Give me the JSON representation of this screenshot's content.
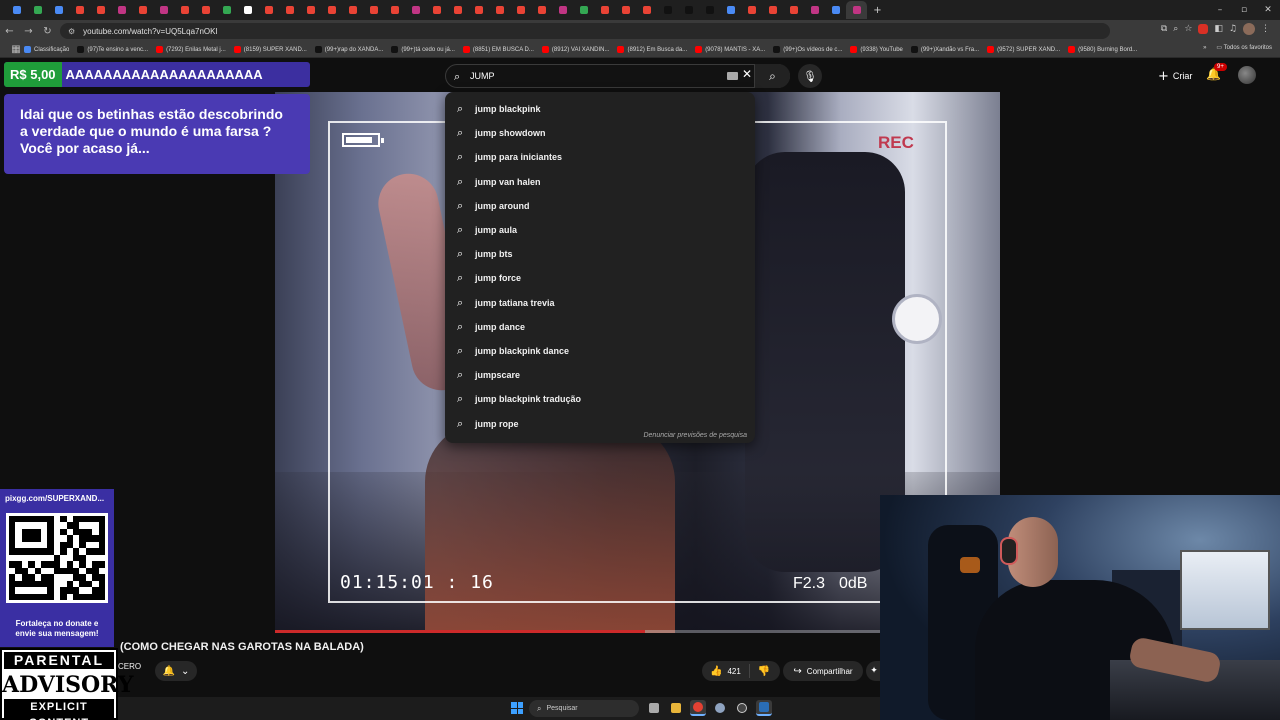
{
  "browser": {
    "url": "youtube.com/watch?v=UQ5Lqa7nOKI",
    "bookmarks": [
      {
        "label": "Classificação",
        "color": "#4a8af4"
      },
      {
        "label": "(97)Te ensino a venc...",
        "color": "#111111"
      },
      {
        "label": "(7292) Enilas Metal j...",
        "color": "#ff0000"
      },
      {
        "label": "(8159) SUPER XAND...",
        "color": "#ff0000"
      },
      {
        "label": "(99+)rap do XANDÃ...",
        "color": "#111111"
      },
      {
        "label": "(99+)tá cedo ou já...",
        "color": "#111111"
      },
      {
        "label": "(8851) EM BUSCA D...",
        "color": "#ff0000"
      },
      {
        "label": "(8912) VAI XANDIN...",
        "color": "#ff0000"
      },
      {
        "label": "(8912) Em Busca da...",
        "color": "#ff0000"
      },
      {
        "label": "(9078) MANTIS - XA...",
        "color": "#ff0000"
      },
      {
        "label": "(99+)Os vídeos de c...",
        "color": "#111111"
      },
      {
        "label": "(9338) YouTube",
        "color": "#ff0000"
      },
      {
        "label": "(99+)Xandão vs Fra...",
        "color": "#111111"
      },
      {
        "label": "(9572) SUPER XAND...",
        "color": "#ff0000"
      },
      {
        "label": "(9580) Burning Bord...",
        "color": "#ff0000"
      }
    ],
    "all_bookmarks": "Todos os favoritos"
  },
  "youtube": {
    "search_value": "JUMP",
    "create_label": "Criar",
    "notifications_badge": "9+",
    "suggestions": [
      "jump blackpink",
      "jump showdown",
      "jump para iniciantes",
      "jump van halen",
      "jump around",
      "jump aula",
      "jump bts",
      "jump force",
      "jump tatiana trevia",
      "jump dance",
      "jump blackpink dance",
      "jumpscare",
      "jump blackpink tradução",
      "jump rope"
    ],
    "report_label": "Denunciar previsões de pesquisa",
    "video_title": "(COMO CHEGAR NAS GAROTAS NA BALADA)",
    "channel_fragment": "CERO",
    "likes": "421",
    "share_label": "Compartilhar",
    "progress_fraction": 0.51
  },
  "overlay": {
    "ticker_amount": "R$ 5,00",
    "ticker_message": "AAAAAAAAAAAAAAAAAAAAA",
    "alert_text": "Idai que os betinhas estão descobrindo a verdade que o mundo é uma farsa ? Você por acaso já...",
    "pix_url": "pixgg.com/SUPERXAND...",
    "pix_message_line1": "Fortaleça no donate e",
    "pix_message_line2": "envie sua mensagem!",
    "advisory_line1": "PARENTAL",
    "advisory_line2": "ADVISORY",
    "advisory_line3": "EXPLICIT CONTENT"
  },
  "video_overlay": {
    "rec_label": "REC",
    "timecode": "01:15:01 : 16",
    "fstop": "F2.3",
    "db": "0dB"
  },
  "taskbar": {
    "search_placeholder": "Pesquisar"
  }
}
